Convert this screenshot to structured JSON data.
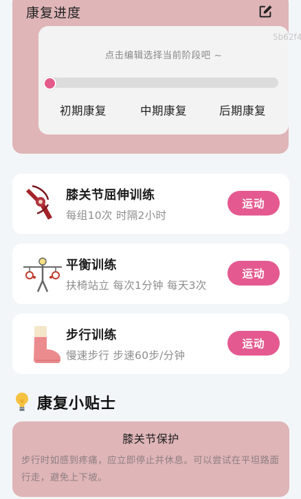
{
  "progress": {
    "title": "康复进度",
    "edit_icon": "edit-square-icon",
    "watermark": "5b62f4",
    "hint": "点击编辑选择当前阶段吧 ~",
    "current_stage_fraction": 0,
    "stages": [
      "初期康复",
      "中期康复",
      "后期康复"
    ]
  },
  "exercises": [
    {
      "title": "膝关节屈伸训练",
      "desc": "每组10次 时隔2小时",
      "button": "运动",
      "icon": "knee-joint-icon"
    },
    {
      "title": "平衡训练",
      "desc": "扶椅站立 每次1分钟 每天3次",
      "button": "运动",
      "icon": "balance-training-icon"
    },
    {
      "title": "步行训练",
      "desc": "慢速步行 步速60步/分钟",
      "button": "运动",
      "icon": "foot-icon"
    }
  ],
  "tips": {
    "heading": "康复小贴士",
    "icon": "lightbulb-icon",
    "card_title": "膝关节保护",
    "card_text": "步行时如感到疼痛，应立即停止并休息。可以尝试在平坦路面行走，避免上下坡。"
  },
  "colors": {
    "accent": "#e45a90",
    "card_pink": "#dfb5b8",
    "background": "#f3f6f8"
  }
}
